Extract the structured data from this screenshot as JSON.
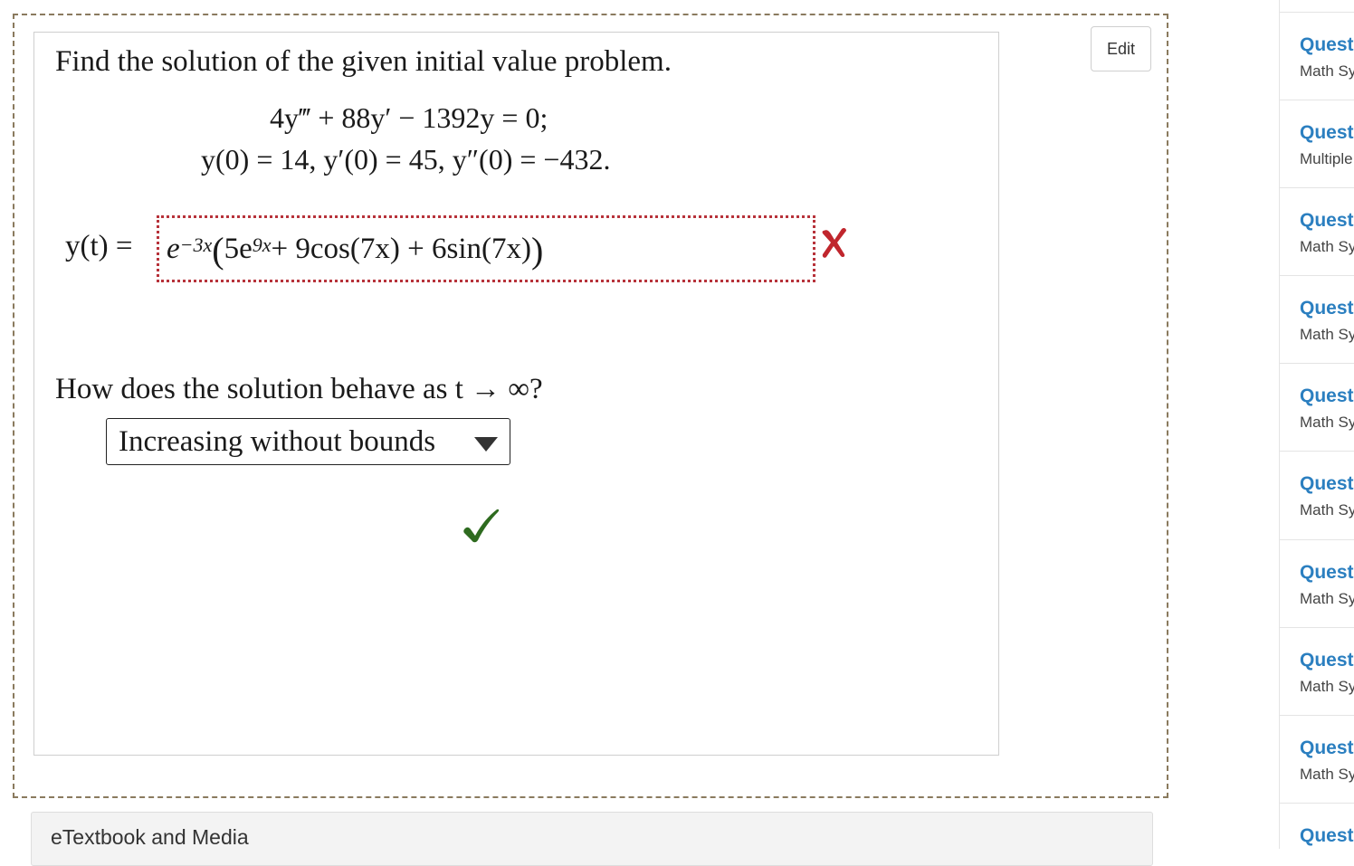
{
  "question": {
    "prompt": "Find the solution of the given initial value problem.",
    "equation_line1": "4y‴ + 88y′ − 1392y = 0;",
    "equation_line2": "y(0) = 14,  y′(0) = 45,  y″(0) = −432.",
    "answer_label": "y(t) =",
    "answer_parts": {
      "base": "e",
      "exp1": "−3x",
      "open": "(",
      "coef1": "5e",
      "exp2": "9x",
      "rest": " + 9cos(7x) + 6sin(7x)",
      "close": ")"
    },
    "answer_status": "incorrect",
    "behavior_question": "How does the solution behave as t → ∞?",
    "behavior_selected": "Increasing without bounds",
    "behavior_status": "correct"
  },
  "edit_label": "Edit",
  "etextbook_label": "eTextbook and Media",
  "sidebar": {
    "items": [
      {
        "title": "Quest",
        "subtitle": "Math Sy"
      },
      {
        "title": "Quest",
        "subtitle": "Multiple"
      },
      {
        "title": "Quest",
        "subtitle": "Math Sy"
      },
      {
        "title": "Quest",
        "subtitle": "Math Sy"
      },
      {
        "title": "Quest",
        "subtitle": "Math Sy"
      },
      {
        "title": "Quest",
        "subtitle": "Math Sy"
      },
      {
        "title": "Quest",
        "subtitle": "Math Sy"
      },
      {
        "title": "Quest",
        "subtitle": "Math Sy"
      },
      {
        "title": "Quest",
        "subtitle": "Math Sy"
      },
      {
        "title": "Quest",
        "subtitle": ""
      }
    ]
  },
  "colors": {
    "link_blue": "#2b7fc0",
    "error_red": "#c0262d",
    "success_green": "#2e6b1f"
  },
  "icons": {
    "answer_status": "x-mark-icon",
    "behavior_status": "check-mark-icon",
    "dropdown": "caret-down-icon"
  }
}
